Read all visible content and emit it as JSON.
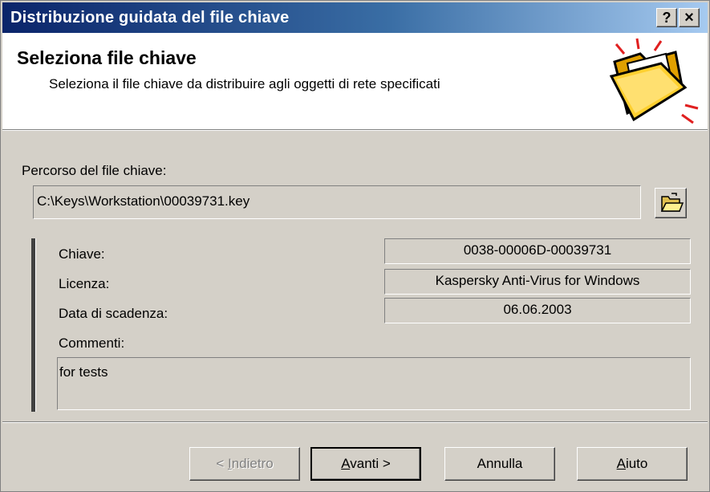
{
  "window": {
    "title": "Distribuzione guidata del file chiave",
    "help_button": "?",
    "close_button": "×"
  },
  "header": {
    "heading": "Seleziona file chiave",
    "description": "Seleziona il file chiave da distribuire agli oggetti di rete specificati",
    "icon": "folder-icon"
  },
  "form": {
    "path_label": "Percorso del file chiave:",
    "path_value": "C:\\Keys\\Workstation\\00039731.key",
    "browse_icon": "open-folder-icon",
    "key_label": "Chiave:",
    "key_value": "0038-00006D-00039731",
    "license_label": "Licenza:",
    "license_value": "Kaspersky Anti-Virus for Windows",
    "expiry_label": "Data di scadenza:",
    "expiry_value": "06.06.2003",
    "comments_label": "Commenti:",
    "comments_value": "for tests"
  },
  "buttons": {
    "back": {
      "prefix": "< ",
      "mnemonic": "I",
      "rest": "ndietro"
    },
    "next": {
      "prefix": "",
      "mnemonic": "A",
      "rest": "vanti >"
    },
    "cancel": "Annulla",
    "help": {
      "prefix": "",
      "mnemonic": "A",
      "rest": "iuto"
    }
  }
}
